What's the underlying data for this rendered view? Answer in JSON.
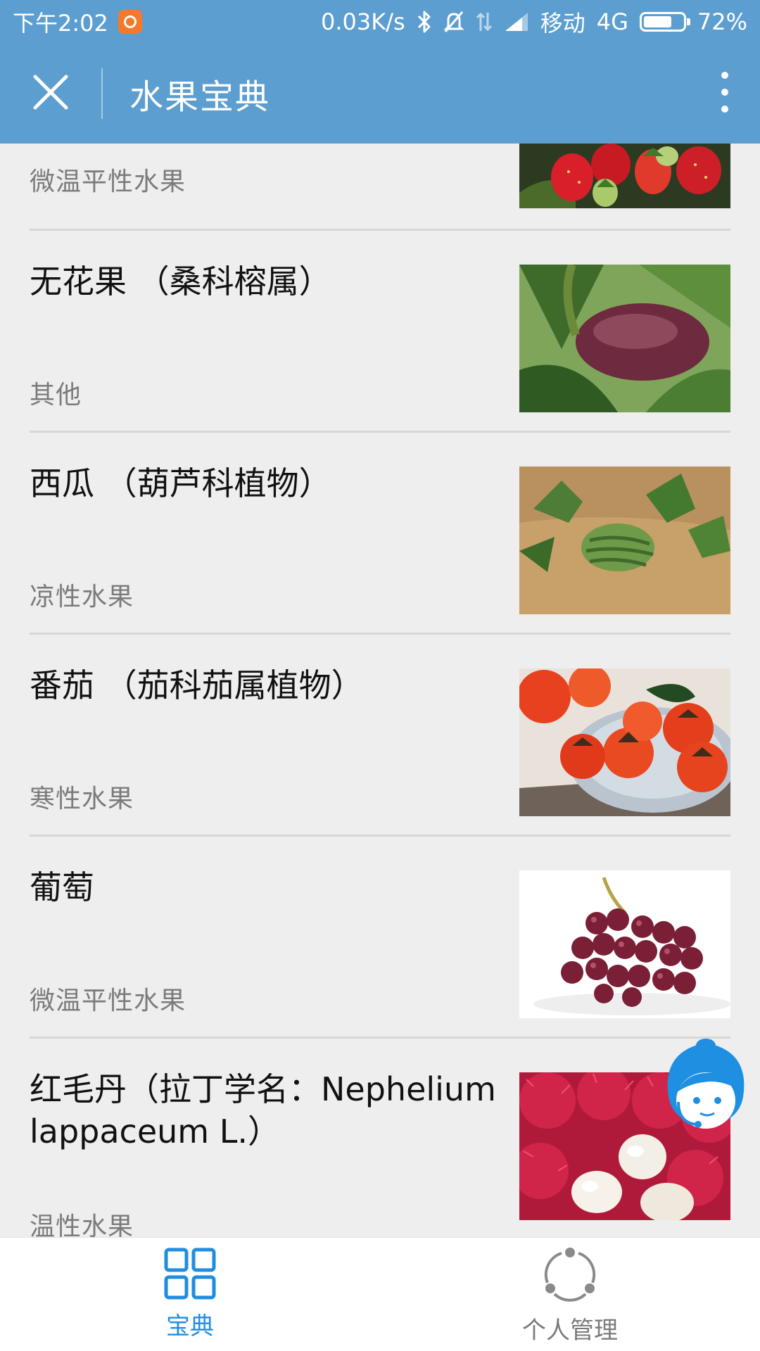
{
  "status_bar": {
    "time": "下午2:02",
    "speed": "0.03K/s",
    "carrier": "移动",
    "network": "4G",
    "battery": "72%",
    "battery_level": 0.72,
    "icons": [
      "mi-notification-icon",
      "bluetooth-icon",
      "mute-bell-icon",
      "data-arrows-icon",
      "signal-icon",
      "battery-icon"
    ]
  },
  "header": {
    "title": "水果宝典",
    "icons": [
      "close-icon",
      "more-vertical-icon"
    ]
  },
  "fruits": [
    {
      "name": "",
      "category": "微温平性水果",
      "image": "strawberry"
    },
    {
      "name": "无花果 （桑科榕属）",
      "category": "其他",
      "image": "fig"
    },
    {
      "name": "西瓜 （葫芦科植物）",
      "category": "凉性水果",
      "image": "watermelon"
    },
    {
      "name": "番茄 （茄科茄属植物）",
      "category": "寒性水果",
      "image": "persimmon-plate"
    },
    {
      "name": "葡萄",
      "category": "微温平性水果",
      "image": "grapes"
    },
    {
      "name": "红毛丹（拉丁学名：Nephelium lappaceum L.）",
      "category": "温性水果",
      "image": "rambutan"
    }
  ],
  "tabbar": {
    "tabs": [
      {
        "label": "宝典",
        "icon": "grid-icon",
        "active": true
      },
      {
        "label": "个人管理",
        "icon": "circle-dots-icon",
        "active": false
      }
    ]
  },
  "colors": {
    "primary": "#5d9ed0",
    "active_tab": "#1f8ee0",
    "background": "#eeeeee",
    "muted_text": "#7b7b7b"
  }
}
